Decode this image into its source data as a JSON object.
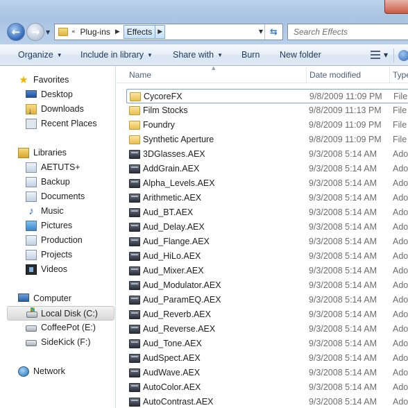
{
  "address": {
    "overflow": "«",
    "crumbs": [
      "Plug-ins",
      "Effects"
    ],
    "search_placeholder": "Search Effects"
  },
  "commands": {
    "organize": "Organize",
    "include_in_library": "Include in library",
    "share_with": "Share with",
    "burn": "Burn",
    "new_folder": "New folder"
  },
  "nav": {
    "favorites": {
      "label": "Favorites",
      "items": [
        "Desktop",
        "Downloads",
        "Recent Places"
      ]
    },
    "libraries": {
      "label": "Libraries",
      "items": [
        "AETUTS+",
        "Backup",
        "Documents",
        "Music",
        "Pictures",
        "Production",
        "Projects",
        "Videos"
      ]
    },
    "computer": {
      "label": "Computer",
      "items": [
        "Local Disk (C:)",
        "CoffeePot (E:)",
        "SideKick (F:)"
      ],
      "selected": "Local Disk (C:)"
    },
    "network": {
      "label": "Network"
    }
  },
  "columns": {
    "name": "Name",
    "date_modified": "Date modified",
    "type": "Type"
  },
  "files": [
    {
      "name": "CycoreFX",
      "date": "9/8/2009 11:09 PM",
      "type": "File f",
      "kind": "folder"
    },
    {
      "name": "Film Stocks",
      "date": "9/8/2009 11:13 PM",
      "type": "File f",
      "kind": "folder"
    },
    {
      "name": "Foundry",
      "date": "9/8/2009 11:09 PM",
      "type": "File f",
      "kind": "folder"
    },
    {
      "name": "Synthetic Aperture",
      "date": "9/8/2009 11:09 PM",
      "type": "File f",
      "kind": "folder"
    },
    {
      "name": "3DGlasses.AEX",
      "date": "9/3/2008 5:14 AM",
      "type": "Adob",
      "kind": "aex"
    },
    {
      "name": "AddGrain.AEX",
      "date": "9/3/2008 5:14 AM",
      "type": "Adob",
      "kind": "aex"
    },
    {
      "name": "Alpha_Levels.AEX",
      "date": "9/3/2008 5:14 AM",
      "type": "Adob",
      "kind": "aex"
    },
    {
      "name": "Arithmetic.AEX",
      "date": "9/3/2008 5:14 AM",
      "type": "Adob",
      "kind": "aex"
    },
    {
      "name": "Aud_BT.AEX",
      "date": "9/3/2008 5:14 AM",
      "type": "Adob",
      "kind": "aex"
    },
    {
      "name": "Aud_Delay.AEX",
      "date": "9/3/2008 5:14 AM",
      "type": "Adob",
      "kind": "aex"
    },
    {
      "name": "Aud_Flange.AEX",
      "date": "9/3/2008 5:14 AM",
      "type": "Adob",
      "kind": "aex"
    },
    {
      "name": "Aud_HiLo.AEX",
      "date": "9/3/2008 5:14 AM",
      "type": "Adob",
      "kind": "aex"
    },
    {
      "name": "Aud_Mixer.AEX",
      "date": "9/3/2008 5:14 AM",
      "type": "Adob",
      "kind": "aex"
    },
    {
      "name": "Aud_Modulator.AEX",
      "date": "9/3/2008 5:14 AM",
      "type": "Adob",
      "kind": "aex"
    },
    {
      "name": "Aud_ParamEQ.AEX",
      "date": "9/3/2008 5:14 AM",
      "type": "Adob",
      "kind": "aex"
    },
    {
      "name": "Aud_Reverb.AEX",
      "date": "9/3/2008 5:14 AM",
      "type": "Adob",
      "kind": "aex"
    },
    {
      "name": "Aud_Reverse.AEX",
      "date": "9/3/2008 5:14 AM",
      "type": "Adob",
      "kind": "aex"
    },
    {
      "name": "Aud_Tone.AEX",
      "date": "9/3/2008 5:14 AM",
      "type": "Adob",
      "kind": "aex"
    },
    {
      "name": "AudSpect.AEX",
      "date": "9/3/2008 5:14 AM",
      "type": "Adob",
      "kind": "aex"
    },
    {
      "name": "AudWave.AEX",
      "date": "9/3/2008 5:14 AM",
      "type": "Adob",
      "kind": "aex"
    },
    {
      "name": "AutoColor.AEX",
      "date": "9/3/2008 5:14 AM",
      "type": "Adob",
      "kind": "aex"
    },
    {
      "name": "AutoContrast.AEX",
      "date": "9/3/2008 5:14 AM",
      "type": "Adob",
      "kind": "aex"
    }
  ],
  "focused_file": "CycoreFX",
  "icons": {
    "back": "back-arrow-icon",
    "forward": "forward-arrow-icon",
    "refresh": "refresh-icon",
    "views": "views-icon",
    "help": "help-icon"
  },
  "colors": {
    "command_text": "#1e395b",
    "header_text": "#4c607a",
    "secondary_text": "#6d6d6d",
    "focus_border": "#7da2ce"
  }
}
